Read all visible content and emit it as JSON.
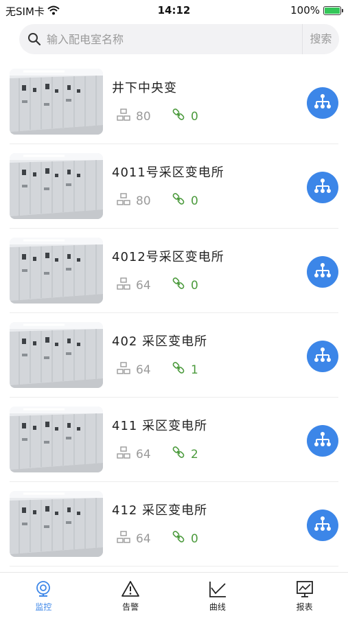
{
  "status_bar": {
    "carrier": "无SIM卡",
    "time": "14:12",
    "battery": "100%"
  },
  "search": {
    "placeholder": "输入配电室名称",
    "button_label": "搜索"
  },
  "rooms": [
    {
      "name": "井下中央变",
      "devices": "80",
      "links": "0"
    },
    {
      "name": "4011号采区变电所",
      "devices": "80",
      "links": "0"
    },
    {
      "name": "4012号采区变电所",
      "devices": "64",
      "links": "0"
    },
    {
      "name": "402 采区变电所",
      "devices": "64",
      "links": "1"
    },
    {
      "name": "411 采区变电所",
      "devices": "64",
      "links": "2"
    },
    {
      "name": "412 采区变电所",
      "devices": "64",
      "links": "0"
    }
  ],
  "icons": {
    "device": "device-icon",
    "link": "link-icon",
    "topology": "topology-icon"
  },
  "tabs": [
    {
      "label": "监控",
      "icon": "monitor-icon",
      "active": true
    },
    {
      "label": "告警",
      "icon": "alarm-icon",
      "active": false
    },
    {
      "label": "曲线",
      "icon": "curve-icon",
      "active": false
    },
    {
      "label": "报表",
      "icon": "report-icon",
      "active": false
    }
  ],
  "colors": {
    "accent": "#3c86e8",
    "link_green": "#4b9a3c",
    "muted": "#9a9a9a"
  }
}
